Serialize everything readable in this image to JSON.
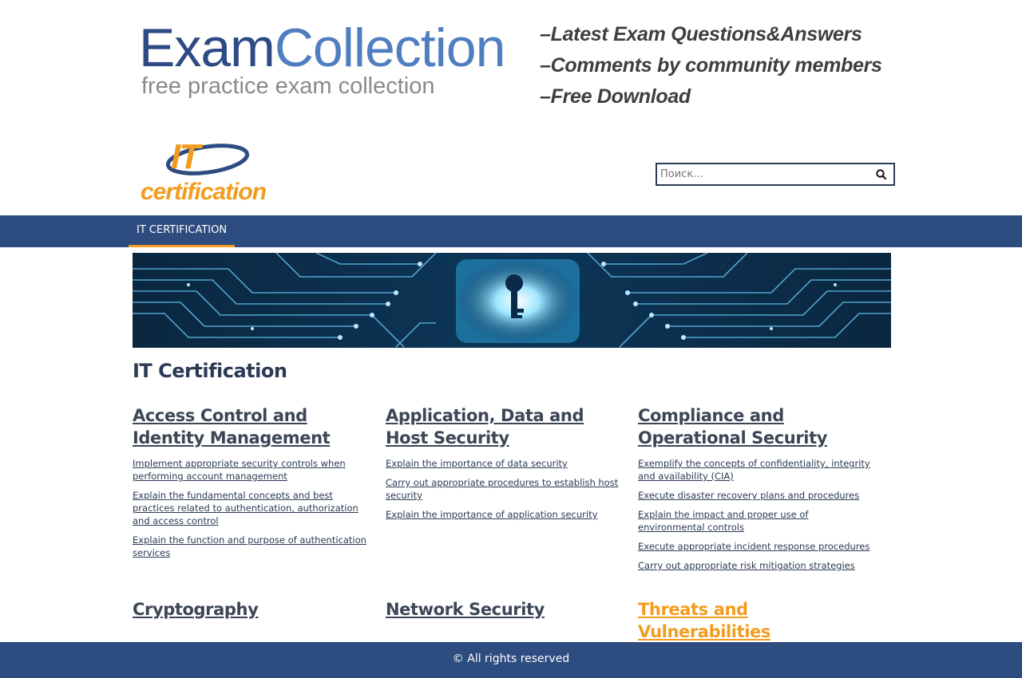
{
  "banner": {
    "logo_exam": "Exam",
    "logo_collection": "Collection",
    "logo_tagline": "free practice exam collection",
    "features": [
      "–Latest Exam Questions&Answers",
      "–Comments by community members",
      "–Free Download"
    ]
  },
  "site_logo": {
    "it": "IT",
    "certification": "certification"
  },
  "search": {
    "placeholder": "Поиск...",
    "icon": "search-icon"
  },
  "nav": {
    "items": [
      {
        "label": "IT CERTIFICATION"
      }
    ]
  },
  "page": {
    "title": "IT Certification"
  },
  "categories": [
    {
      "title": "Access Control and Identity Management",
      "links": [
        "Implement appropriate security controls when performing account management",
        "Explain the fundamental concepts and best practices related to authentication, authorization and access control",
        "Explain the function and purpose of authentication services"
      ]
    },
    {
      "title": "Application, Data and Host Security",
      "links": [
        "Explain the importance of data security",
        "Carry out appropriate procedures to establish host security",
        "Explain the importance of application security"
      ]
    },
    {
      "title": "Compliance and Operational Security",
      "links": [
        "Exemplify the concepts of confidentiality, integrity and availability (CIA)",
        "Execute disaster recovery plans and procedures",
        "Explain the impact and proper use of environmental controls",
        "Execute appropriate incident response procedures",
        "Carry out appropriate risk mitigation strategies"
      ]
    },
    {
      "title": "Cryptography",
      "links": []
    },
    {
      "title": "Network Security",
      "links": []
    },
    {
      "title": "Threats and Vulnerabilities",
      "links": []
    }
  ],
  "footer": {
    "text": "© All rights reserved"
  },
  "colors": {
    "brand_blue": "#2d4c80",
    "accent_orange": "#f29c1f",
    "text_dark": "#2b3a55"
  }
}
